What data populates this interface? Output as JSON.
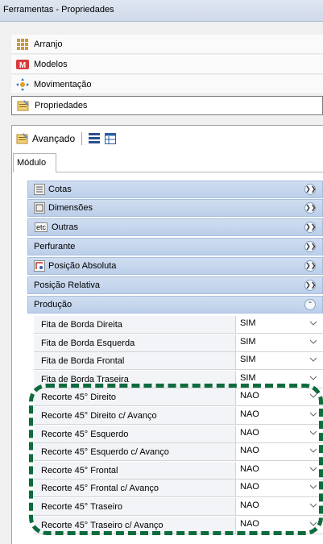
{
  "window": {
    "title": "Ferramentas - Propriedades"
  },
  "nav": [
    {
      "label": "Arranjo",
      "icon": "arrangement-icon"
    },
    {
      "label": "Modelos",
      "icon": "models-icon"
    },
    {
      "label": "Movimentação",
      "icon": "movement-icon"
    },
    {
      "label": "Propriedades",
      "icon": "properties-icon"
    }
  ],
  "toolbar": {
    "advanced_label": "Avançado"
  },
  "tabs": {
    "module": "Módulo"
  },
  "categories": [
    {
      "label": "Cotas",
      "state": "collapsed"
    },
    {
      "label": "Dimensões",
      "state": "collapsed"
    },
    {
      "label": "Outras",
      "icon_text": "etc",
      "state": "collapsed"
    },
    {
      "label": "Perfurante",
      "state": "collapsed"
    },
    {
      "label": "Posição Absoluta",
      "state": "collapsed"
    },
    {
      "label": "Posição Relativa",
      "state": "collapsed"
    },
    {
      "label": "Produção",
      "state": "expanded"
    }
  ],
  "properties": [
    {
      "label": "Fita de Borda Direita",
      "value": "SIM"
    },
    {
      "label": "Fita de Borda Esquerda",
      "value": "SIM"
    },
    {
      "label": "Fita de Borda Frontal",
      "value": "SIM"
    },
    {
      "label": "Fita de Borda Traseira",
      "value": "SIM"
    },
    {
      "label": "Recorte 45° Direito",
      "value": "NAO"
    },
    {
      "label": "Recorte 45° Direito c/ Avanço",
      "value": "NAO"
    },
    {
      "label": "Recorte 45° Esquerdo",
      "value": "NAO"
    },
    {
      "label": "Recorte 45° Esquerdo c/ Avanço",
      "value": "NAO"
    },
    {
      "label": "Recorte 45° Frontal",
      "value": "NAO"
    },
    {
      "label": "Recorte 45° Frontal c/ Avanço",
      "value": "NAO"
    },
    {
      "label": "Recorte 45° Traseiro",
      "value": "NAO"
    },
    {
      "label": "Recorte 45° Traseiro c/ Avanço",
      "value": "NAO"
    }
  ],
  "colors": {
    "highlight_dash": "#0d6b3c",
    "category_bg": "#c6d6ee"
  }
}
